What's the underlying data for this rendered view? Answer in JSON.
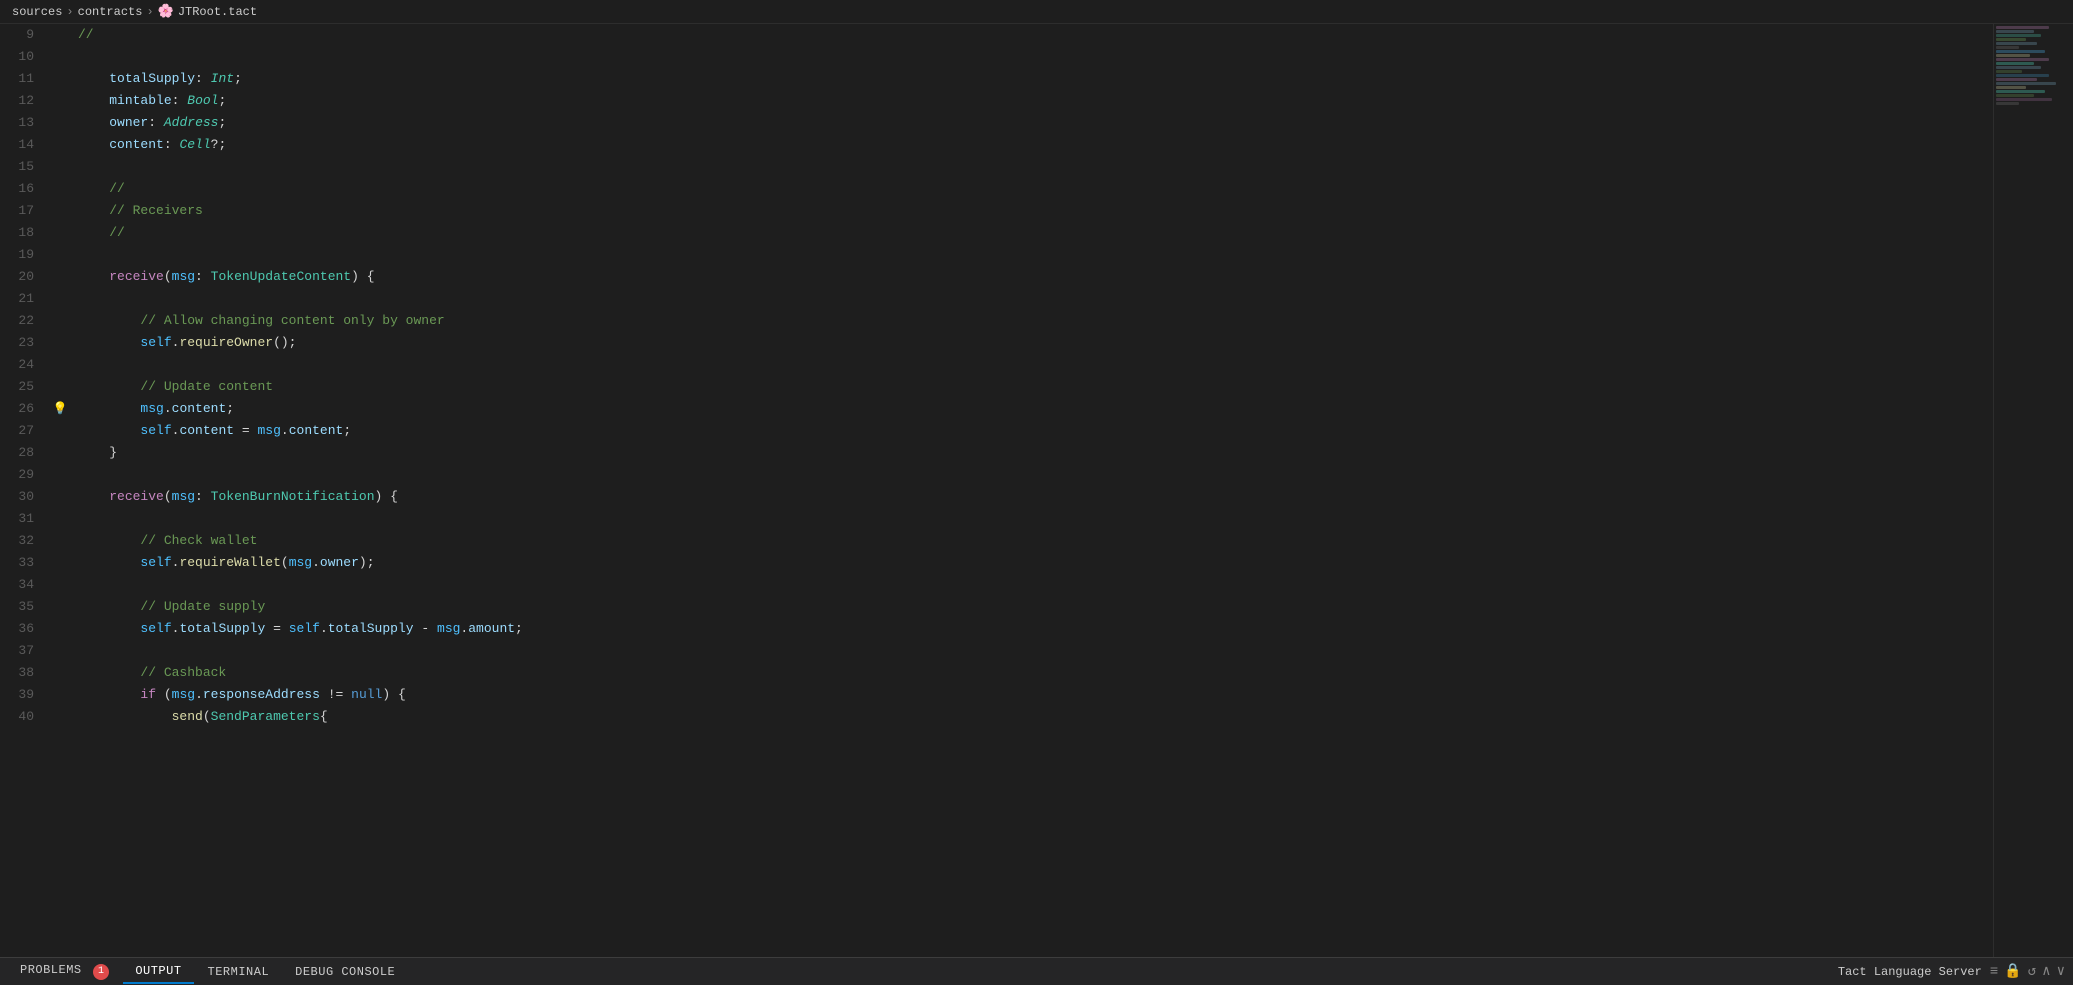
{
  "breadcrumb": {
    "parts": [
      "sources",
      "contracts"
    ],
    "icon": "🌸",
    "file": "JTRoot.tact"
  },
  "editor": {
    "lines": [
      {
        "num": 9,
        "gutter": "",
        "code": "<comment>//</comment>"
      },
      {
        "num": 10,
        "gutter": "",
        "code": ""
      },
      {
        "num": 11,
        "gutter": "",
        "code": "    <field-name>totalSupply</field-name><punct>:</punct> <type-builtin>Int</type-builtin><punct>;</punct>"
      },
      {
        "num": 12,
        "gutter": "",
        "code": "    <field-name>mintable</field-name><punct>:</punct> <type-builtin>Bool</type-builtin><punct>;</punct>"
      },
      {
        "num": 13,
        "gutter": "",
        "code": "    <field-name>owner</field-name><punct>:</punct> <type-builtin>Address</type-builtin><punct>;</punct>"
      },
      {
        "num": 14,
        "gutter": "",
        "code": "    <field-name>content</field-name><punct>:</punct> <type-builtin>Cell</type-builtin><punct>?;</punct>"
      },
      {
        "num": 15,
        "gutter": "",
        "code": ""
      },
      {
        "num": 16,
        "gutter": "",
        "code": "    <comment>//</comment>"
      },
      {
        "num": 17,
        "gutter": "",
        "code": "    <comment>// Receivers</comment>"
      },
      {
        "num": 18,
        "gutter": "",
        "code": "    <comment>//</comment>"
      },
      {
        "num": 19,
        "gutter": "",
        "code": ""
      },
      {
        "num": 20,
        "gutter": "",
        "code": "    <kw-receive>receive</kw-receive><punct>(</punct><prop>msg</prop><punct>:</punct> <type-name>TokenUpdateContent</type-name><punct>) {</punct>"
      },
      {
        "num": 21,
        "gutter": "",
        "code": ""
      },
      {
        "num": 22,
        "gutter": "",
        "code": "        <comment>// Allow changing content only by owner</comment>"
      },
      {
        "num": 23,
        "gutter": "",
        "code": "        <kw-self>self</kw-self><punct>.</punct><fn-name>requireOwner</fn-name><punct>();</punct>"
      },
      {
        "num": 24,
        "gutter": "",
        "code": ""
      },
      {
        "num": 25,
        "gutter": "",
        "code": "        <comment>// Update content</comment>"
      },
      {
        "num": 26,
        "gutter": "💡",
        "code": "        <prop>msg</prop><punct>.</punct><field-name>content</field-name><punct>;</punct>"
      },
      {
        "num": 27,
        "gutter": "",
        "code": "        <kw-self>self</kw-self><punct>.</punct><field-name>content</field-name> <op>=</op> <prop>msg</prop><punct>.</punct><field-name>content</field-name><punct>;</punct>"
      },
      {
        "num": 28,
        "gutter": "",
        "code": "    <punct>}</punct>"
      },
      {
        "num": 29,
        "gutter": "",
        "code": ""
      },
      {
        "num": 30,
        "gutter": "",
        "code": "    <kw-receive>receive</kw-receive><punct>(</punct><prop>msg</prop><punct>:</punct> <type-name>TokenBurnNotification</type-name><punct>) {</punct>"
      },
      {
        "num": 31,
        "gutter": "",
        "code": ""
      },
      {
        "num": 32,
        "gutter": "",
        "code": "        <comment>// Check wallet</comment>"
      },
      {
        "num": 33,
        "gutter": "",
        "code": "        <kw-self>self</kw-self><punct>.</punct><fn-name>requireWallet</fn-name><punct>(</punct><prop>msg</prop><punct>.</punct><field-name>owner</field-name><punct>);</punct>"
      },
      {
        "num": 34,
        "gutter": "",
        "code": ""
      },
      {
        "num": 35,
        "gutter": "",
        "code": "        <comment>// Update supply</comment>"
      },
      {
        "num": 36,
        "gutter": "",
        "code": "        <kw-self>self</kw-self><punct>.</punct><field-name>totalSupply</field-name> <op>=</op> <kw-self>self</kw-self><punct>.</punct><field-name>totalSupply</field-name> <op>-</op> <prop>msg</prop><punct>.</punct><field-name>amount</field-name><punct>;</punct>"
      },
      {
        "num": 37,
        "gutter": "",
        "code": ""
      },
      {
        "num": 38,
        "gutter": "",
        "code": "        <comment>// Cashback</comment>"
      },
      {
        "num": 39,
        "gutter": "",
        "code": "        <kw-if>if</kw-if> <punct>(</punct><prop>msg</prop><punct>.</punct><field-name>responseAddress</field-name> <op>!=</op> <kw-null>null</kw-null><punct>) {</punct>"
      },
      {
        "num": 40,
        "gutter": "",
        "code": "            <kw-send>send</kw-send><punct>(</punct><type-name>SendParameters</type-name><punct>{</punct>"
      }
    ]
  },
  "status_bar": {
    "tabs": [
      {
        "label": "PROBLEMS",
        "badge": "1",
        "active": false
      },
      {
        "label": "OUTPUT",
        "active": true
      },
      {
        "label": "TERMINAL",
        "active": false
      },
      {
        "label": "DEBUG CONSOLE",
        "active": false
      }
    ],
    "server": "Tact Language Server",
    "icons": [
      "≡",
      "🔒",
      "↺",
      "∧",
      "∨"
    ]
  }
}
